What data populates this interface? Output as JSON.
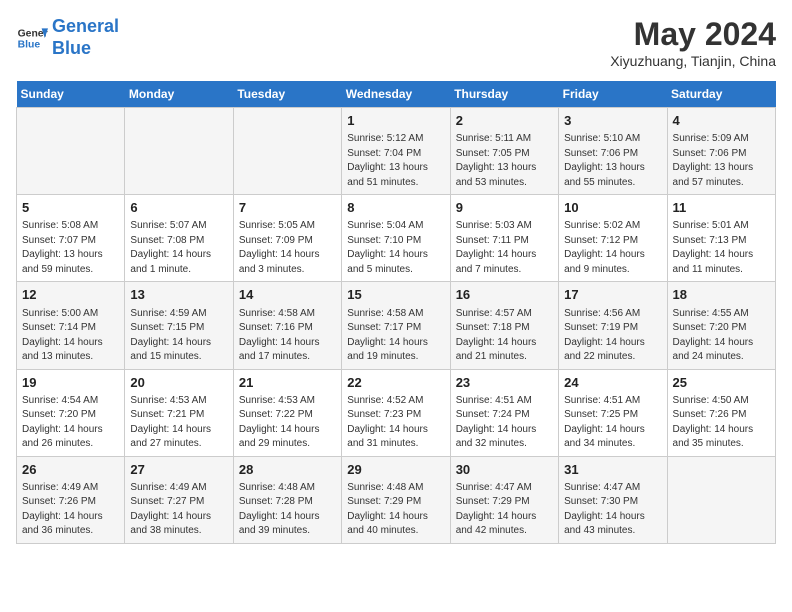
{
  "header": {
    "logo_line1": "General",
    "logo_line2": "Blue",
    "title": "May 2024",
    "subtitle": "Xiyuzhuang, Tianjin, China"
  },
  "weekdays": [
    "Sunday",
    "Monday",
    "Tuesday",
    "Wednesday",
    "Thursday",
    "Friday",
    "Saturday"
  ],
  "weeks": [
    [
      {
        "day": "",
        "info": ""
      },
      {
        "day": "",
        "info": ""
      },
      {
        "day": "",
        "info": ""
      },
      {
        "day": "1",
        "info": "Sunrise: 5:12 AM\nSunset: 7:04 PM\nDaylight: 13 hours\nand 51 minutes."
      },
      {
        "day": "2",
        "info": "Sunrise: 5:11 AM\nSunset: 7:05 PM\nDaylight: 13 hours\nand 53 minutes."
      },
      {
        "day": "3",
        "info": "Sunrise: 5:10 AM\nSunset: 7:06 PM\nDaylight: 13 hours\nand 55 minutes."
      },
      {
        "day": "4",
        "info": "Sunrise: 5:09 AM\nSunset: 7:06 PM\nDaylight: 13 hours\nand 57 minutes."
      }
    ],
    [
      {
        "day": "5",
        "info": "Sunrise: 5:08 AM\nSunset: 7:07 PM\nDaylight: 13 hours\nand 59 minutes."
      },
      {
        "day": "6",
        "info": "Sunrise: 5:07 AM\nSunset: 7:08 PM\nDaylight: 14 hours\nand 1 minute."
      },
      {
        "day": "7",
        "info": "Sunrise: 5:05 AM\nSunset: 7:09 PM\nDaylight: 14 hours\nand 3 minutes."
      },
      {
        "day": "8",
        "info": "Sunrise: 5:04 AM\nSunset: 7:10 PM\nDaylight: 14 hours\nand 5 minutes."
      },
      {
        "day": "9",
        "info": "Sunrise: 5:03 AM\nSunset: 7:11 PM\nDaylight: 14 hours\nand 7 minutes."
      },
      {
        "day": "10",
        "info": "Sunrise: 5:02 AM\nSunset: 7:12 PM\nDaylight: 14 hours\nand 9 minutes."
      },
      {
        "day": "11",
        "info": "Sunrise: 5:01 AM\nSunset: 7:13 PM\nDaylight: 14 hours\nand 11 minutes."
      }
    ],
    [
      {
        "day": "12",
        "info": "Sunrise: 5:00 AM\nSunset: 7:14 PM\nDaylight: 14 hours\nand 13 minutes."
      },
      {
        "day": "13",
        "info": "Sunrise: 4:59 AM\nSunset: 7:15 PM\nDaylight: 14 hours\nand 15 minutes."
      },
      {
        "day": "14",
        "info": "Sunrise: 4:58 AM\nSunset: 7:16 PM\nDaylight: 14 hours\nand 17 minutes."
      },
      {
        "day": "15",
        "info": "Sunrise: 4:58 AM\nSunset: 7:17 PM\nDaylight: 14 hours\nand 19 minutes."
      },
      {
        "day": "16",
        "info": "Sunrise: 4:57 AM\nSunset: 7:18 PM\nDaylight: 14 hours\nand 21 minutes."
      },
      {
        "day": "17",
        "info": "Sunrise: 4:56 AM\nSunset: 7:19 PM\nDaylight: 14 hours\nand 22 minutes."
      },
      {
        "day": "18",
        "info": "Sunrise: 4:55 AM\nSunset: 7:20 PM\nDaylight: 14 hours\nand 24 minutes."
      }
    ],
    [
      {
        "day": "19",
        "info": "Sunrise: 4:54 AM\nSunset: 7:20 PM\nDaylight: 14 hours\nand 26 minutes."
      },
      {
        "day": "20",
        "info": "Sunrise: 4:53 AM\nSunset: 7:21 PM\nDaylight: 14 hours\nand 27 minutes."
      },
      {
        "day": "21",
        "info": "Sunrise: 4:53 AM\nSunset: 7:22 PM\nDaylight: 14 hours\nand 29 minutes."
      },
      {
        "day": "22",
        "info": "Sunrise: 4:52 AM\nSunset: 7:23 PM\nDaylight: 14 hours\nand 31 minutes."
      },
      {
        "day": "23",
        "info": "Sunrise: 4:51 AM\nSunset: 7:24 PM\nDaylight: 14 hours\nand 32 minutes."
      },
      {
        "day": "24",
        "info": "Sunrise: 4:51 AM\nSunset: 7:25 PM\nDaylight: 14 hours\nand 34 minutes."
      },
      {
        "day": "25",
        "info": "Sunrise: 4:50 AM\nSunset: 7:26 PM\nDaylight: 14 hours\nand 35 minutes."
      }
    ],
    [
      {
        "day": "26",
        "info": "Sunrise: 4:49 AM\nSunset: 7:26 PM\nDaylight: 14 hours\nand 36 minutes."
      },
      {
        "day": "27",
        "info": "Sunrise: 4:49 AM\nSunset: 7:27 PM\nDaylight: 14 hours\nand 38 minutes."
      },
      {
        "day": "28",
        "info": "Sunrise: 4:48 AM\nSunset: 7:28 PM\nDaylight: 14 hours\nand 39 minutes."
      },
      {
        "day": "29",
        "info": "Sunrise: 4:48 AM\nSunset: 7:29 PM\nDaylight: 14 hours\nand 40 minutes."
      },
      {
        "day": "30",
        "info": "Sunrise: 4:47 AM\nSunset: 7:29 PM\nDaylight: 14 hours\nand 42 minutes."
      },
      {
        "day": "31",
        "info": "Sunrise: 4:47 AM\nSunset: 7:30 PM\nDaylight: 14 hours\nand 43 minutes."
      },
      {
        "day": "",
        "info": ""
      }
    ]
  ]
}
